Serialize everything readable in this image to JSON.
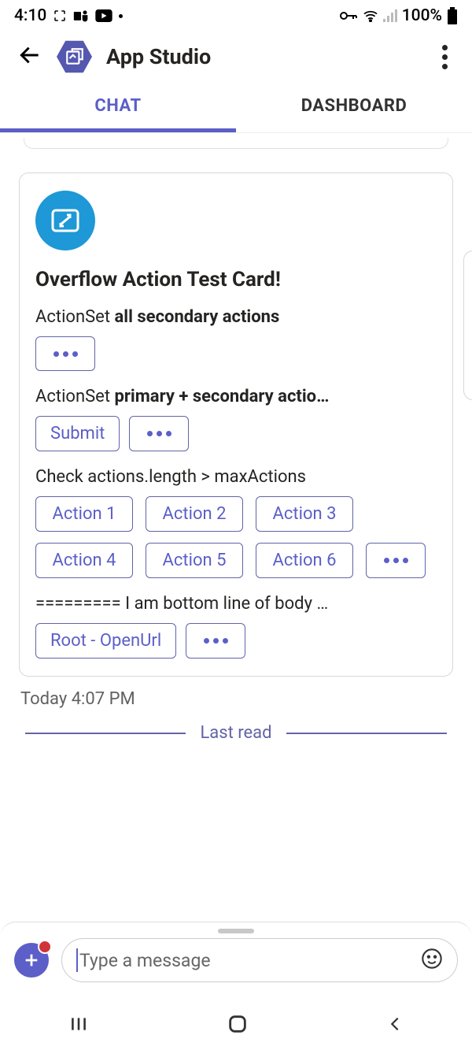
{
  "status": {
    "time": "4:10",
    "battery": "100%"
  },
  "app": {
    "title": "App Studio"
  },
  "tabs": {
    "chat": "CHAT",
    "dashboard": "DASHBOARD"
  },
  "card": {
    "title": "Overflow Action Test Card!",
    "section1_prefix": "ActionSet ",
    "section1_bold": "all secondary actions",
    "section2_prefix": "ActionSet ",
    "section2_bold": "primary + secondary actio…",
    "submit": "Submit",
    "section3": "Check actions.length > maxActions",
    "actions": {
      "a1": "Action 1",
      "a2": "Action 2",
      "a3": "Action 3",
      "a4": "Action 4",
      "a5": "Action 5",
      "a6": "Action 6"
    },
    "bottom_line": "========= I am bottom line of body …",
    "root_openurl": "Root - OpenUrl"
  },
  "timestamp": "Today 4:07 PM",
  "last_read": "Last read",
  "composer": {
    "placeholder": "Type a message"
  }
}
